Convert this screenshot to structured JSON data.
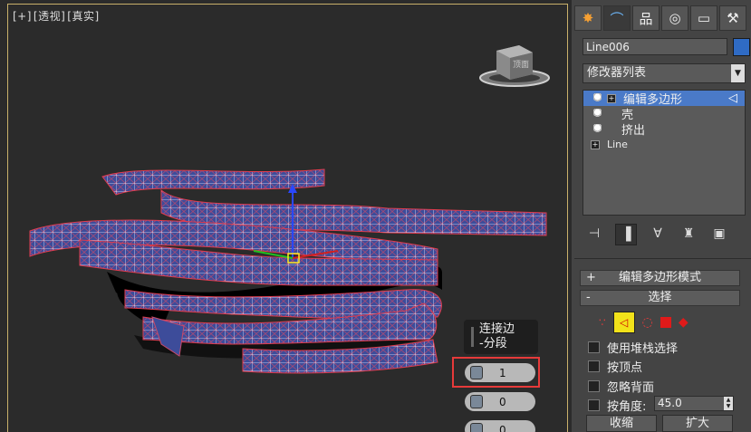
{
  "viewport": {
    "label_parts": [
      "[+]",
      "[透视]",
      "[真实]"
    ],
    "viewcube_face": "顶面"
  },
  "caddy": {
    "title_line1": "连接边",
    "title_line2": "-分段",
    "segments_value": "1",
    "pinch_value": "0",
    "slide_value": "0"
  },
  "panel": {
    "tabs": [
      {
        "name": "create",
        "icon": "sun-icon",
        "glyph": "✸"
      },
      {
        "name": "modify",
        "icon": "modify-icon",
        "glyph": "⌒"
      },
      {
        "name": "hierarchy",
        "icon": "hierarchy-icon",
        "glyph": "品"
      },
      {
        "name": "motion",
        "icon": "motion-icon",
        "glyph": "◎"
      },
      {
        "name": "display",
        "icon": "monitor-icon",
        "glyph": "▭"
      },
      {
        "name": "utilities",
        "icon": "hammer-icon",
        "glyph": "⚒"
      }
    ],
    "object_name": "Line006",
    "object_color": "#2f6bc4",
    "modifier_list_label": "修改器列表",
    "stack": [
      {
        "label": "编辑多边形",
        "selected": true,
        "has_plus": true
      },
      {
        "label": "壳",
        "selected": false,
        "has_plus": false
      },
      {
        "label": "挤出",
        "selected": false,
        "has_plus": false
      },
      {
        "label": "Line",
        "selected": false,
        "has_plus": true
      }
    ],
    "rollout_editpoly": {
      "sign": "+",
      "title": "编辑多边形模式"
    },
    "rollout_selection": {
      "sign": "-",
      "title": "选择"
    },
    "checkboxes": {
      "use_stack": "使用堆栈选择",
      "by_vertex": "按顶点",
      "ignore_backface": "忽略背面",
      "by_angle": "按角度:"
    },
    "angle_value": "45.0",
    "shrink_label": "收缩",
    "grow_label": "扩大"
  },
  "colors": {
    "accent_selection": "#4a7ac8",
    "highlight_red": "#e63a3a",
    "viewport_border": "#c9b16a"
  }
}
